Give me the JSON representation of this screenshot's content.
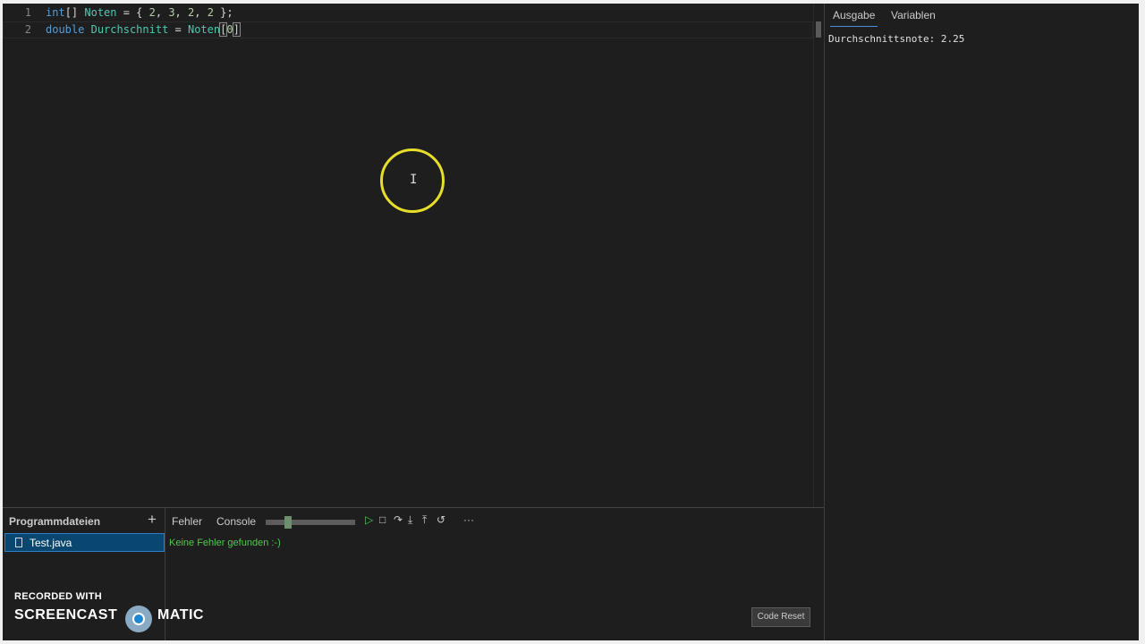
{
  "editor": {
    "lines": [
      {
        "number": "1",
        "tokens": [
          {
            "text": "int",
            "kind": "kw"
          },
          {
            "text": "[] ",
            "kind": "punc"
          },
          {
            "text": "Noten",
            "kind": "ident"
          },
          {
            "text": " = { ",
            "kind": "punc"
          },
          {
            "text": "2",
            "kind": "num"
          },
          {
            "text": ", ",
            "kind": "punc"
          },
          {
            "text": "3",
            "kind": "num"
          },
          {
            "text": ", ",
            "kind": "punc"
          },
          {
            "text": "2",
            "kind": "num"
          },
          {
            "text": ", ",
            "kind": "punc"
          },
          {
            "text": "2",
            "kind": "num"
          },
          {
            "text": " };",
            "kind": "punc"
          }
        ]
      },
      {
        "number": "2",
        "tokens": [
          {
            "text": "double",
            "kind": "kw"
          },
          {
            "text": " ",
            "kind": "punc"
          },
          {
            "text": "Durchschnitt",
            "kind": "ident"
          },
          {
            "text": " = ",
            "kind": "punc"
          },
          {
            "text": "Noten",
            "kind": "ident"
          },
          {
            "text": "[",
            "kind": "bracket-hl"
          },
          {
            "text": "0",
            "kind": "num"
          },
          {
            "text": "]",
            "kind": "bracket-hl"
          }
        ]
      }
    ],
    "cursor_glyph": "I"
  },
  "right_panel": {
    "tabs": [
      {
        "label": "Ausgabe",
        "active": true
      },
      {
        "label": "Variablen",
        "active": false
      }
    ],
    "output": "Durchschnittsnote: 2.25"
  },
  "files_panel": {
    "title": "Programmdateien",
    "add_icon": "+",
    "files": [
      {
        "name": "Test.java",
        "selected": true
      }
    ]
  },
  "console_panel": {
    "tabs": [
      "Fehler",
      "Console"
    ],
    "speed_slider": {
      "value": 0.25
    },
    "controls": [
      {
        "name": "run-icon",
        "glyph": "▷"
      },
      {
        "name": "stop-icon",
        "glyph": "□"
      },
      {
        "name": "step-over-icon",
        "glyph": "↷"
      },
      {
        "name": "step-into-icon",
        "glyph": "⤓"
      },
      {
        "name": "step-out-icon",
        "glyph": "⤒"
      },
      {
        "name": "restart-icon",
        "glyph": "↺"
      },
      {
        "name": "more-icon",
        "glyph": "···"
      }
    ],
    "status": "Keine Fehler gefunden :-)",
    "reset_label": "Code Reset"
  },
  "watermark": {
    "line1": "RECORDED WITH",
    "left": "SCREENCAST",
    "right": "MATIC"
  },
  "colors": {
    "background": "#1e1e1e",
    "keyword": "#569cd6",
    "identifier": "#4ec9b0",
    "number": "#b5cea8",
    "success": "#4ec94e",
    "selection": "#094771",
    "cursor_highlight": "#e6de2a"
  }
}
